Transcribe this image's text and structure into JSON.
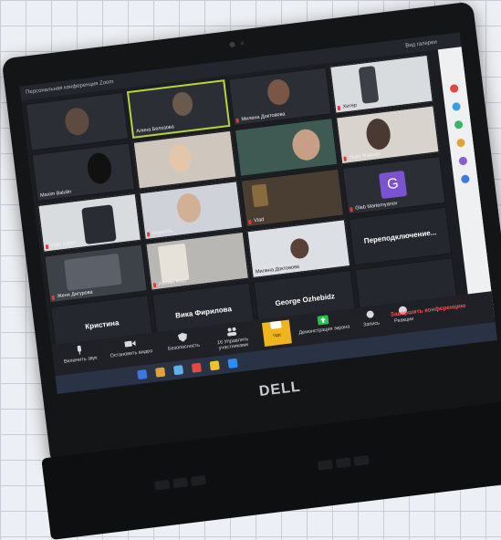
{
  "window": {
    "title": "Персональная конференция Zoom",
    "view_label": "Вид галереи"
  },
  "participants": [
    {
      "name": "",
      "mic_muted": false
    },
    {
      "name": "Алина Белозова",
      "mic_muted": false,
      "active_speaker": true
    },
    {
      "name": "Милена Доктовова",
      "mic_muted": true
    },
    {
      "name": "Хитер",
      "mic_muted": true
    },
    {
      "name": "Maxim Balulin",
      "mic_muted": false
    },
    {
      "name": "",
      "mic_muted": false
    },
    {
      "name": "",
      "mic_muted": false
    },
    {
      "name": "Лера Жакова",
      "mic_muted": true
    },
    {
      "name": "Hala Nikitin",
      "mic_muted": true
    },
    {
      "name": "Марсель",
      "mic_muted": true
    },
    {
      "name": "Vlad",
      "mic_muted": true
    },
    {
      "name": "Gleb Martemyanov",
      "mic_muted": true,
      "avatar_letter": "G"
    },
    {
      "name": "Женя Дигурова",
      "mic_muted": true
    },
    {
      "name": "Аблиш Artur",
      "mic_muted": true
    },
    {
      "name": "Милена Доктовова",
      "mic_muted": false
    },
    {
      "name": "Переподключение...",
      "mic_muted": false,
      "name_centered": true
    },
    {
      "name": "Кристина",
      "mic_muted": false,
      "name_centered": true
    },
    {
      "name": "Вика Фирилова",
      "mic_muted": false,
      "name_centered": true
    },
    {
      "name": "George Ozhebidz",
      "mic_muted": true,
      "name_centered": true
    },
    {
      "name": "",
      "mic_muted": false,
      "name_centered": true
    }
  ],
  "toolbar": {
    "mute_label": "Включить звук",
    "video_label": "Остановить видео",
    "security_label": "Безопасность",
    "participants_label": "Управлять участниками",
    "participants_count": "16",
    "chat_label": "Чат",
    "share_label": "Демонстрация экрана",
    "record_label": "Запись",
    "reactions_label": "Реакции",
    "end_label": "Завершить конференцию"
  },
  "device": {
    "brand": "DELL"
  },
  "colors": {
    "active_speaker_border": "#b6d43a",
    "end_button": "#ff4d4d",
    "chat_highlight": "#f0b51e",
    "avatar_bg": "#7b52d1"
  }
}
